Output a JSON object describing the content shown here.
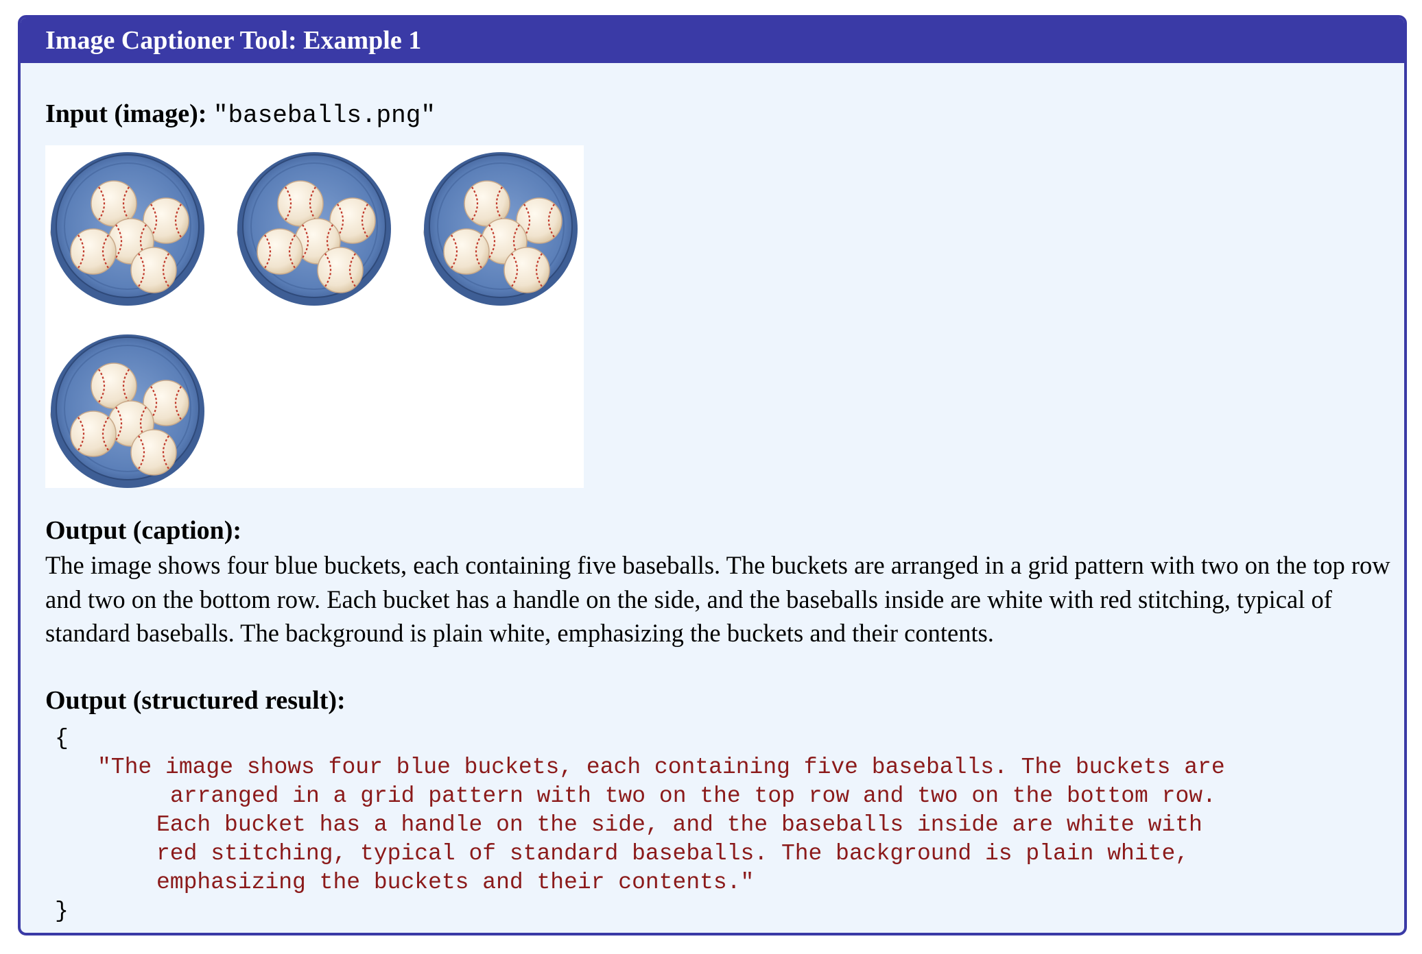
{
  "header": {
    "title": "Image Captioner Tool: Example 1"
  },
  "input": {
    "label": "Input (image):",
    "filename": "\"baseballs.png\""
  },
  "image": {
    "bucket_count": 4,
    "balls_per_bucket": 5
  },
  "caption": {
    "label": "Output (caption):",
    "text": "The image shows four blue buckets, each containing five baseballs. The buckets are arranged in a grid pattern with two on the top row and two on the bottom row. Each bucket has a handle on the side, and the baseballs inside are white with red stitching, typical of standard baseballs. The background is plain white, emphasizing the buckets and their contents."
  },
  "structured": {
    "label": "Output (structured result):",
    "open_brace": "{",
    "close_brace": "}",
    "lines": [
      "\"The image shows four blue buckets, each containing five baseballs. The buckets are",
      "arranged in a grid pattern with two on the top row and two on the bottom row.",
      "Each bucket has a handle on the side, and the baseballs inside are white with",
      "red stitching, typical of standard baseballs. The background is plain white,",
      "emphasizing the buckets and their contents.\""
    ]
  },
  "colors": {
    "frame": "#3a3aa6",
    "panel_bg": "#eef5fd",
    "bucket_blue": "#5b7fb8",
    "string_red": "#8b1a1a"
  }
}
